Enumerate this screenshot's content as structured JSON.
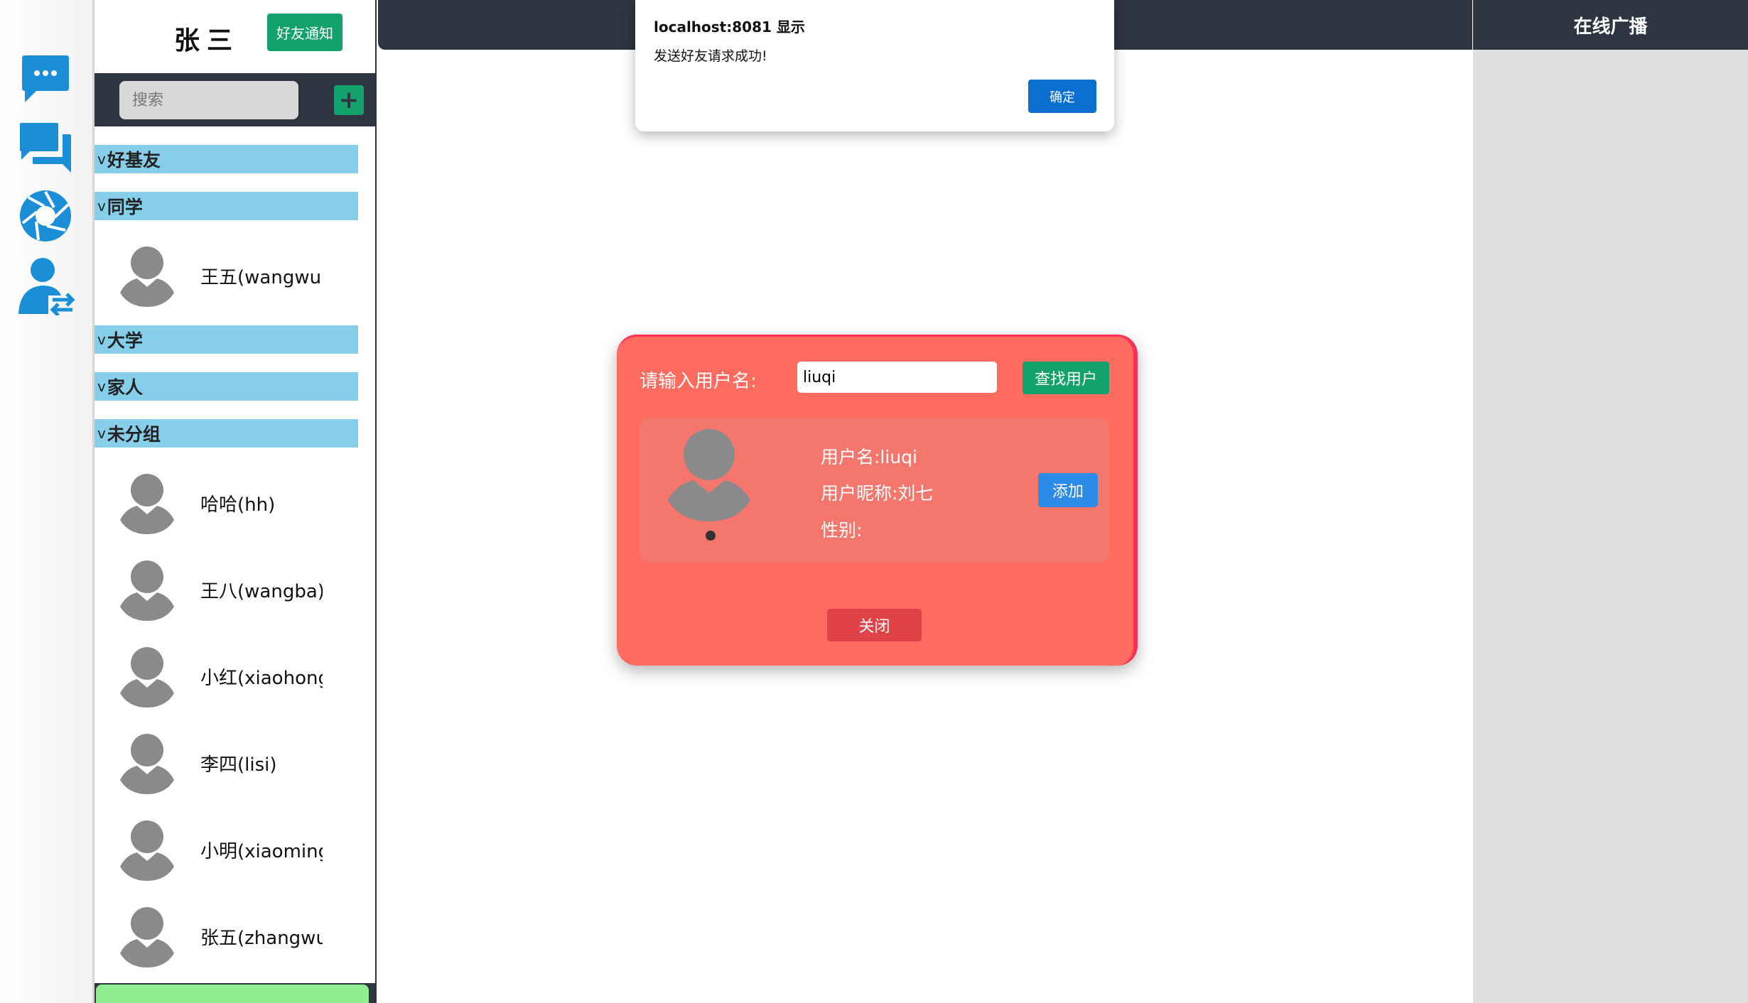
{
  "colors": {
    "dark": "#2e3440",
    "green": "#13a26d",
    "group_bg": "#87ceeb",
    "icon_blue": "#1a8fd8",
    "modal_bg": "#ff6b5f",
    "broadcast_bg": "#e0e0e0"
  },
  "rail": {
    "icons": [
      "chat-bubble-icon",
      "messages-icon",
      "shutter-icon",
      "user-switch-icon"
    ]
  },
  "sidebar": {
    "username": "张三",
    "notify_button": "好友通知",
    "search_placeholder": "搜索",
    "add_button": "+",
    "groups": [
      {
        "name": "好基友",
        "members": []
      },
      {
        "name": "同学",
        "members": [
          "王五(wangwu)"
        ]
      },
      {
        "name": "大学",
        "members": []
      },
      {
        "name": "家人",
        "members": []
      },
      {
        "name": "未分组",
        "members": [
          "哈哈(hh)",
          "王八(wangba)",
          "小红(xiaohong",
          "李四(lisi)",
          "小明(xiaoming",
          "张五(zhangwu"
        ]
      }
    ],
    "chevron": "v"
  },
  "broadcast": {
    "title": "在线广播"
  },
  "alert": {
    "title": "localhost:8081 显示",
    "message": "发送好友请求成功!",
    "ok_button": "确定"
  },
  "add_friend": {
    "label": "请输入用户名:",
    "input_value": "liuqi",
    "find_button": "查找用户",
    "result": {
      "username": "用户名:liuqi",
      "nickname": "用户昵称:刘七",
      "gender": "性别:"
    },
    "add_button": "添加",
    "close_button": "关闭"
  }
}
